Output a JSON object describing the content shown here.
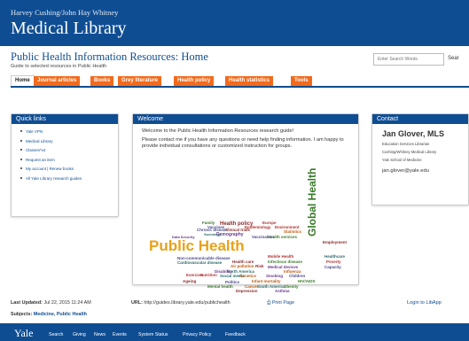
{
  "banner": {
    "subtitle": "Harvey Cushing/John Hay Whitney",
    "title": "Medical Library"
  },
  "guide": {
    "title": "Public Health Information Resources: Home",
    "description": "Guide to selected resources in Public Health"
  },
  "search": {
    "placeholder": "Enter Search Words",
    "button": "Sear"
  },
  "tabs": [
    "Home",
    "Journal articles",
    "Books",
    "Grey literature",
    "Health policy",
    "Health statistics",
    "Tools"
  ],
  "quick_links": {
    "heading": "Quick links",
    "items": [
      "Yale VPN",
      "Medical Library",
      "Classes*v2",
      "Request an item",
      "My account | Renew books",
      "All Yale Library research guides"
    ]
  },
  "welcome": {
    "heading": "Welcome",
    "p1": "Welcome to the Public Health Information Resources research guide!",
    "p2": "Please contact me if you have any questions or need help finding information. I am happy to provide individual consultations or customized instruction for groups."
  },
  "contact": {
    "heading": "Contact",
    "name": "Jan Glover, MLS",
    "lines": [
      "Education Services Librarian",
      "Cushing/Whitney Medical Library",
      "Yale School of Medicine"
    ],
    "email": "jan.glover@yale.edu"
  },
  "wordcloud": [
    {
      "text": "Public Health",
      "color": "#e8a21a"
    },
    {
      "text": "Global Health",
      "color": "#3a7a2a"
    },
    {
      "text": "Health policy",
      "color": "#8b2a2a"
    },
    {
      "text": "Chronic disease",
      "color": "#4a4a8a"
    },
    {
      "text": "Demography",
      "color": "#6b3a8a"
    },
    {
      "text": "Epidemiology",
      "color": "#b03030"
    },
    {
      "text": "Sociology",
      "color": "#2a6a6a"
    },
    {
      "text": "Statistics",
      "color": "#c05a10"
    },
    {
      "text": "Health services",
      "color": "#3a7a2a"
    },
    {
      "text": "Vaccines",
      "color": "#4a4a8a"
    },
    {
      "text": "Employment",
      "color": "#8b2a2a"
    },
    {
      "text": "Healthcare",
      "color": "#2a6a6a"
    },
    {
      "text": "Poverty",
      "color": "#b03030"
    },
    {
      "text": "Capacity",
      "color": "#4a4a8a"
    },
    {
      "text": "Air pollution",
      "color": "#c05a10"
    },
    {
      "text": "Infectious disease",
      "color": "#3a7a2a"
    },
    {
      "text": "Risk",
      "color": "#8b2a2a"
    },
    {
      "text": "Medical devices",
      "color": "#6b3a8a"
    },
    {
      "text": "Nutrition",
      "color": "#b03030"
    },
    {
      "text": "Social media",
      "color": "#2a6a6a"
    },
    {
      "text": "Politics",
      "color": "#4a4a8a"
    },
    {
      "text": "Genetics",
      "color": "#c05a10"
    },
    {
      "text": "Family",
      "color": "#3a7a2a"
    },
    {
      "text": "Clinical trials",
      "color": "#8b2a2a"
    },
    {
      "text": "Data Security",
      "color": "#6b3a8a"
    },
    {
      "text": "Exercise",
      "color": "#b03030"
    },
    {
      "text": "Cardiovascular disease",
      "color": "#2a6a6a"
    },
    {
      "text": "Non-communicable disease",
      "color": "#4a4a8a"
    },
    {
      "text": "Influenza",
      "color": "#c05a10"
    },
    {
      "text": "Mental health",
      "color": "#3a7a2a"
    },
    {
      "text": "Ageing",
      "color": "#8b2a2a"
    },
    {
      "text": "Smoking",
      "color": "#6b3a8a"
    },
    {
      "text": "Europe",
      "color": "#b03030"
    },
    {
      "text": "North America",
      "color": "#2a6a6a"
    },
    {
      "text": "Vaccination",
      "color": "#4a4a8a"
    },
    {
      "text": "Infant mortality",
      "color": "#c05a10"
    },
    {
      "text": "HIV/AIDS",
      "color": "#3a7a2a"
    },
    {
      "text": "Health care",
      "color": "#8b2a2a"
    },
    {
      "text": "Disability",
      "color": "#6b3a8a"
    },
    {
      "text": "Environment",
      "color": "#b03030"
    },
    {
      "text": "South America",
      "color": "#2a6a6a"
    },
    {
      "text": "Children",
      "color": "#4a4a8a"
    },
    {
      "text": "Cancer",
      "color": "#c05a10"
    },
    {
      "text": "Obesity",
      "color": "#3a7a2a"
    },
    {
      "text": "Depression",
      "color": "#8b2a2a"
    },
    {
      "text": "Asthma",
      "color": "#6b3a8a"
    },
    {
      "text": "Mobile Health",
      "color": "#b03030"
    }
  ],
  "footer": {
    "last_updated_label": "Last Updated:",
    "last_updated": "Jul 22, 2015 11:24 AM",
    "url_label": "URL:",
    "url": "http://guides.library.yale.edu/publichealth",
    "print": "Print Page",
    "login": "Login to LibApp",
    "subjects_label": "Subjects:",
    "subjects": "Medicine, Public Health"
  },
  "yale": {
    "logo": "Yale",
    "nav": [
      "Search",
      "Giving",
      "News",
      "Events",
      "System Status",
      "Privacy Policy",
      "Feedback"
    ]
  }
}
